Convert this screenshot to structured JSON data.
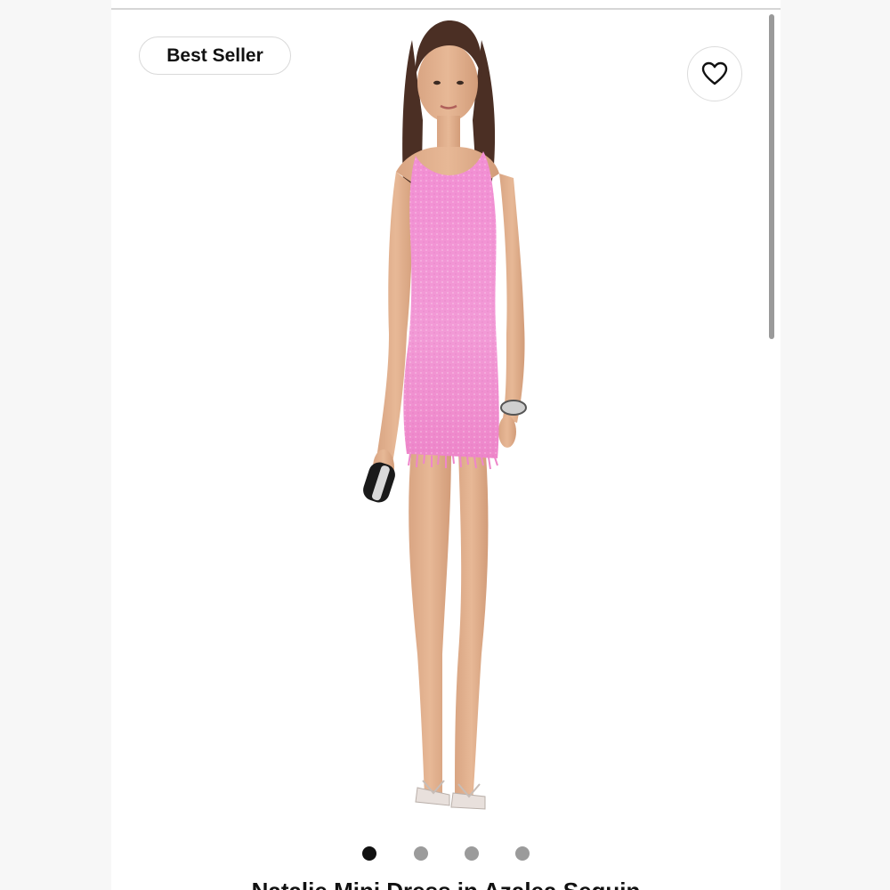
{
  "badge": {
    "label": "Best Seller"
  },
  "favorite": {
    "icon": "heart-icon"
  },
  "product": {
    "title": "Natalie Mini Dress in Azalea Sequin",
    "image_alt": "Model wearing pink sequin knit mini dress with fringe hem"
  },
  "carousel": {
    "count": 4,
    "active_index": 0
  },
  "colors": {
    "dress": "#f08fcf",
    "accent_dark": "#111111",
    "inactive_dot": "#9b9b9b"
  }
}
